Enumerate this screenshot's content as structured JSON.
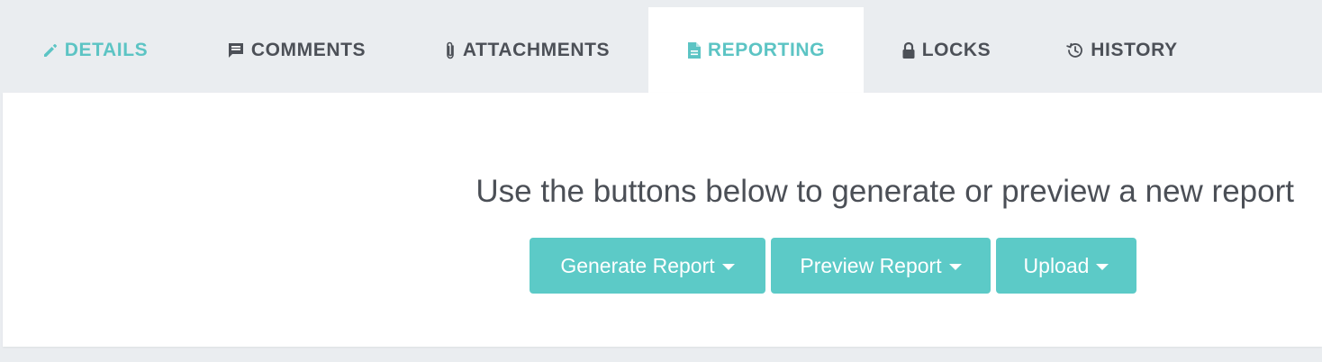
{
  "tabs": [
    {
      "label": "DETAILS",
      "icon": "pencil-icon",
      "color": "#5cc4c4"
    },
    {
      "label": "COMMENTS",
      "icon": "comment-icon",
      "color": "#4c5057"
    },
    {
      "label": "ATTACHMENTS",
      "icon": "paperclip-icon",
      "color": "#4c5057"
    },
    {
      "label": "REPORTING",
      "icon": "document-icon",
      "color": "#5cc4c4",
      "active": true
    },
    {
      "label": "LOCKS",
      "icon": "lock-icon",
      "color": "#4c5057"
    },
    {
      "label": "HISTORY",
      "icon": "history-icon",
      "color": "#4c5057"
    }
  ],
  "reporting": {
    "message": "Use the buttons below to generate or preview a new report",
    "buttons": [
      {
        "label": "Generate Report",
        "icon": "caret-down-icon"
      },
      {
        "label": "Preview Report",
        "icon": "caret-down-icon"
      },
      {
        "label": "Upload",
        "icon": "caret-down-icon"
      }
    ]
  },
  "colors": {
    "accent": "#5ccac7",
    "tab_bar_bg": "#eaedf0",
    "text_dark": "#4c5057"
  }
}
